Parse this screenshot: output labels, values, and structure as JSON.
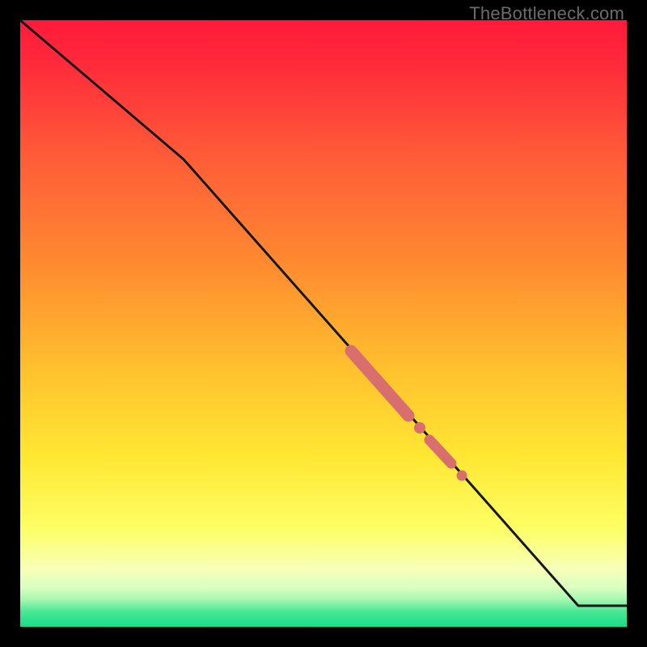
{
  "watermark": "TheBottleneck.com",
  "colors": {
    "bg_black": "#000000",
    "grad_top": "#ff1a3a",
    "grad_mid_orange": "#ff7a2a",
    "grad_yellow": "#ffe733",
    "grad_pale_yellow": "#fbffbf",
    "grad_green": "#24e28a",
    "line": "#171717",
    "marker_fill": "#d86e6e",
    "marker_stroke": "#c85c5c"
  },
  "chart_data": {
    "type": "line",
    "title": "",
    "xlabel": "",
    "ylabel": "",
    "xlim": [
      0,
      100
    ],
    "ylim": [
      0,
      100
    ],
    "grid": false,
    "legend": false,
    "series": [
      {
        "name": "curve",
        "x": [
          0,
          27,
          92,
          100
        ],
        "y": [
          100,
          77,
          3.5,
          3.5
        ]
      }
    ],
    "highlighted_segments": [
      {
        "x0": 54.5,
        "y0": 45.5,
        "x1": 64.0,
        "y1": 34.8,
        "weight": "thick"
      },
      {
        "x0": 65.2,
        "y0": 33.3,
        "x1": 66.2,
        "y1": 32.2,
        "weight": "dot"
      },
      {
        "x0": 67.5,
        "y0": 30.8,
        "x1": 71.0,
        "y1": 26.9,
        "weight": "med"
      },
      {
        "x0": 72.2,
        "y0": 25.5,
        "x1": 73.0,
        "y1": 24.6,
        "weight": "dot"
      }
    ]
  }
}
